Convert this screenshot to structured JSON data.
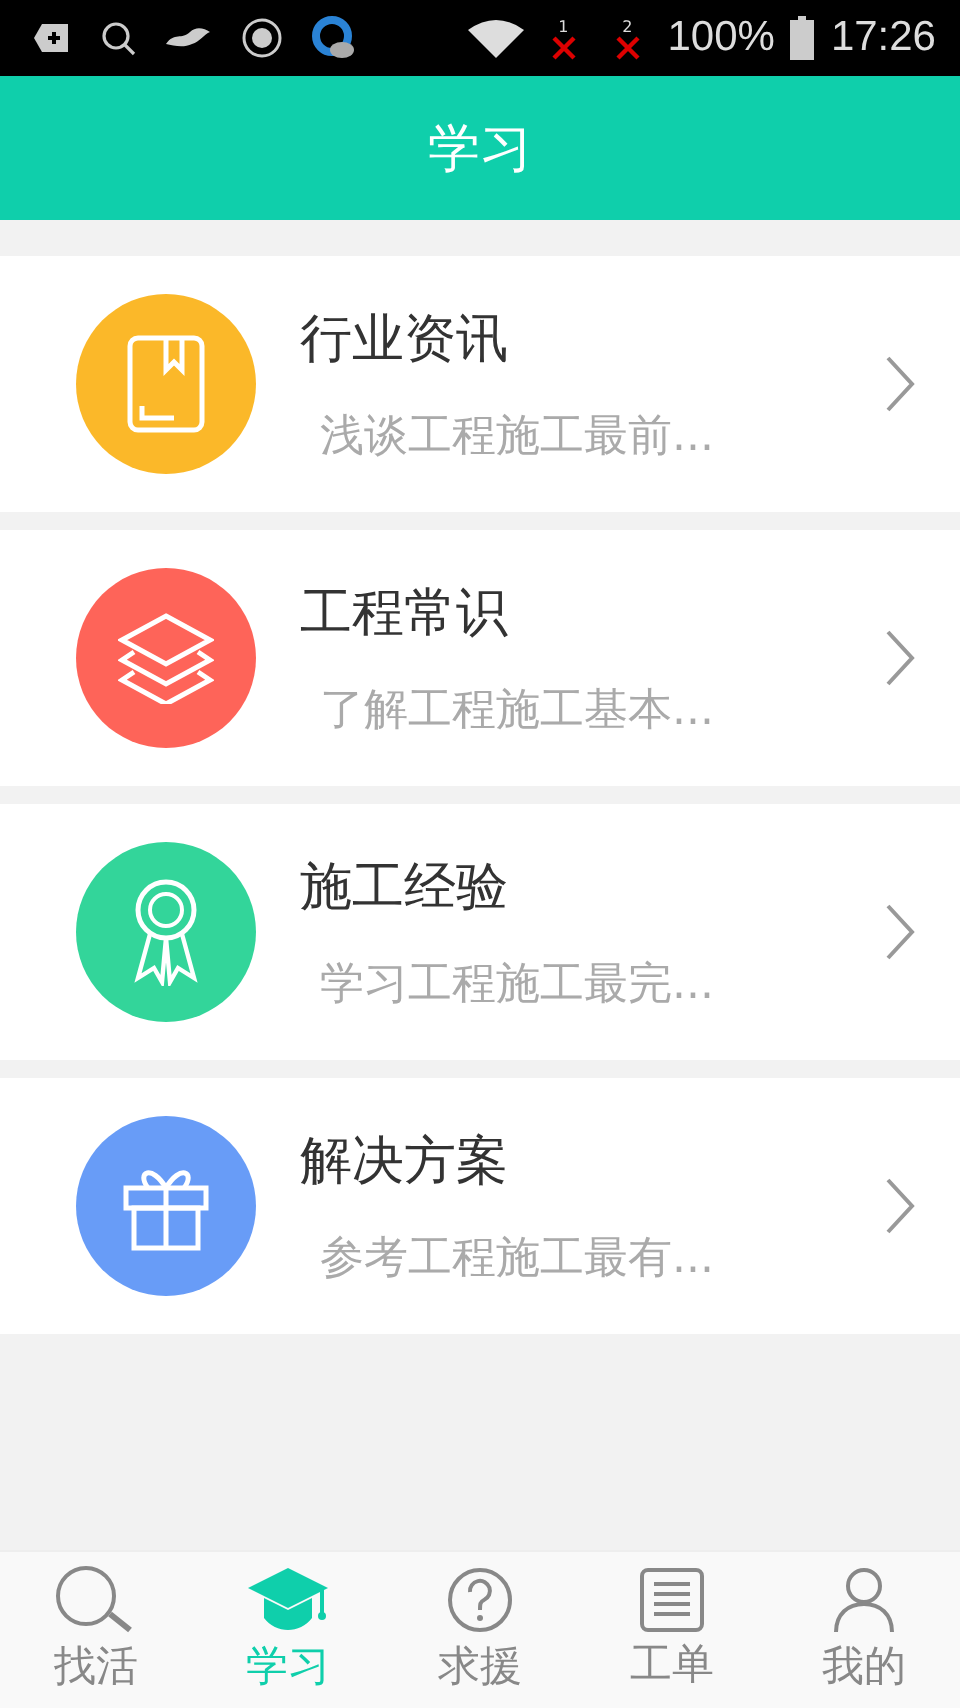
{
  "status_bar": {
    "sim_labels": [
      "1",
      "2"
    ],
    "battery": "100%",
    "time": "17:26"
  },
  "header": {
    "title": "学习"
  },
  "items": [
    {
      "kind": "book",
      "color": "#fbb829",
      "title": "行业资讯",
      "subtitle": "浅谈工程施工最前..."
    },
    {
      "kind": "layers",
      "color": "#fe6459",
      "title": "工程常识",
      "subtitle": "了解工程施工基本..."
    },
    {
      "kind": "ribbon",
      "color": "#33d59a",
      "title": "施工经验",
      "subtitle": "学习工程施工最完..."
    },
    {
      "kind": "gift",
      "color": "#689cf7",
      "title": "解决方案",
      "subtitle": "参考工程施工最有..."
    }
  ],
  "tabs": [
    {
      "kind": "search",
      "label": "找活",
      "selected": false
    },
    {
      "kind": "cap",
      "label": "学习",
      "selected": true
    },
    {
      "kind": "help",
      "label": "求援",
      "selected": false
    },
    {
      "kind": "list",
      "label": "工单",
      "selected": false
    },
    {
      "kind": "person",
      "label": "我的",
      "selected": false
    }
  ]
}
